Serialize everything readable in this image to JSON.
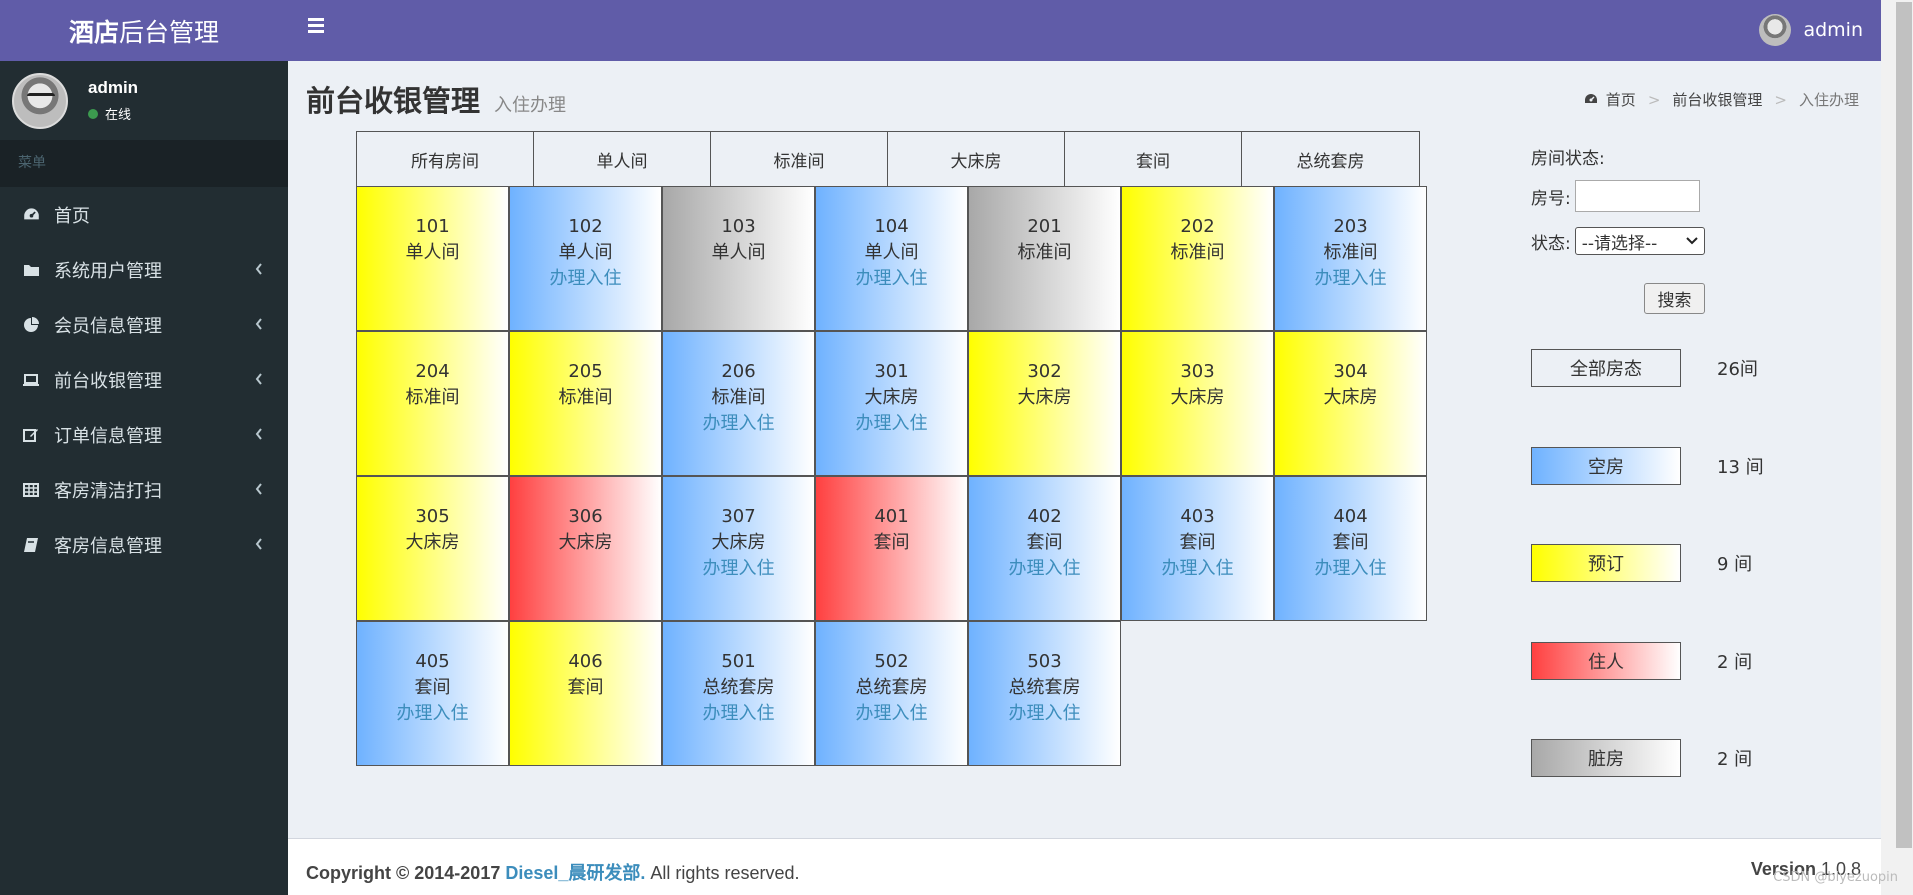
{
  "app": {
    "logo_bold": "酒店",
    "logo_light": "后台管理"
  },
  "user": {
    "name": "admin",
    "status": "在线"
  },
  "sidebar": {
    "header": "菜单",
    "items": [
      {
        "label": "首页",
        "icon": "dashboard-icon",
        "has_children": false
      },
      {
        "label": "系统用户管理",
        "icon": "folder-icon",
        "has_children": true
      },
      {
        "label": "会员信息管理",
        "icon": "pie-chart-icon",
        "has_children": true
      },
      {
        "label": "前台收银管理",
        "icon": "laptop-icon",
        "has_children": true
      },
      {
        "label": "订单信息管理",
        "icon": "edit-icon",
        "has_children": true
      },
      {
        "label": "客房清洁打扫",
        "icon": "table-icon",
        "has_children": true
      },
      {
        "label": "客房信息管理",
        "icon": "book-icon",
        "has_children": true
      }
    ]
  },
  "header": {
    "user_name": "admin"
  },
  "page": {
    "title": "前台收银管理",
    "subtitle": "入住办理"
  },
  "breadcrumb": {
    "home": "首页",
    "section": "前台收银管理",
    "current": "入住办理"
  },
  "tabs": [
    "所有房间",
    "单人间",
    "标准间",
    "大床房",
    "套间",
    "总统套房"
  ],
  "action_label": "办理入住",
  "rooms": [
    {
      "number": "101",
      "type": "单人间",
      "status": "reserved",
      "action": ""
    },
    {
      "number": "102",
      "type": "单人间",
      "status": "empty",
      "action": "办理入住"
    },
    {
      "number": "103",
      "type": "单人间",
      "status": "dirty",
      "action": ""
    },
    {
      "number": "104",
      "type": "单人间",
      "status": "empty",
      "action": "办理入住"
    },
    {
      "number": "201",
      "type": "标准间",
      "status": "dirty",
      "action": ""
    },
    {
      "number": "202",
      "type": "标准间",
      "status": "reserved",
      "action": ""
    },
    {
      "number": "203",
      "type": "标准间",
      "status": "empty",
      "action": "办理入住"
    },
    {
      "number": "204",
      "type": "标准间",
      "status": "reserved",
      "action": ""
    },
    {
      "number": "205",
      "type": "标准间",
      "status": "reserved",
      "action": ""
    },
    {
      "number": "206",
      "type": "标准间",
      "status": "empty",
      "action": "办理入住"
    },
    {
      "number": "301",
      "type": "大床房",
      "status": "empty",
      "action": "办理入住"
    },
    {
      "number": "302",
      "type": "大床房",
      "status": "reserved",
      "action": ""
    },
    {
      "number": "303",
      "type": "大床房",
      "status": "reserved",
      "action": ""
    },
    {
      "number": "304",
      "type": "大床房",
      "status": "reserved",
      "action": ""
    },
    {
      "number": "305",
      "type": "大床房",
      "status": "reserved",
      "action": ""
    },
    {
      "number": "306",
      "type": "大床房",
      "status": "occupied",
      "action": ""
    },
    {
      "number": "307",
      "type": "大床房",
      "status": "empty",
      "action": "办理入住"
    },
    {
      "number": "401",
      "type": "套间",
      "status": "occupied",
      "action": ""
    },
    {
      "number": "402",
      "type": "套间",
      "status": "empty",
      "action": "办理入住"
    },
    {
      "number": "403",
      "type": "套间",
      "status": "empty",
      "action": "办理入住"
    },
    {
      "number": "404",
      "type": "套间",
      "status": "empty",
      "action": "办理入住"
    },
    {
      "number": "405",
      "type": "套间",
      "status": "empty",
      "action": "办理入住"
    },
    {
      "number": "406",
      "type": "套间",
      "status": "reserved",
      "action": ""
    },
    {
      "number": "501",
      "type": "总统套房",
      "status": "empty",
      "action": "办理入住"
    },
    {
      "number": "502",
      "type": "总统套房",
      "status": "empty",
      "action": "办理入住"
    },
    {
      "number": "503",
      "type": "总统套房",
      "status": "empty",
      "action": "办理入住"
    }
  ],
  "filter": {
    "section_label": "房间状态:",
    "room_label": "房号:",
    "room_value": "",
    "status_label": "状态:",
    "status_selected": "--请选择--",
    "search_label": "搜索"
  },
  "legend": [
    {
      "label": "全部房态",
      "count": "26间",
      "status": "all"
    },
    {
      "label": "空房",
      "count": "13 间",
      "status": "empty"
    },
    {
      "label": "预订",
      "count": "9 间",
      "status": "reserved"
    },
    {
      "label": "住人",
      "count": "2 间",
      "status": "occupied"
    },
    {
      "label": "脏房",
      "count": "2 间",
      "status": "dirty"
    }
  ],
  "colors": {
    "header": "#605ca8",
    "sidebar": "#222d32",
    "empty": "#6fb2ff",
    "reserved": "#ffff00",
    "occupied": "#ff4040",
    "dirty": "#a8a8a8",
    "link": "#3c8dbc"
  },
  "footer": {
    "copyright_prefix": "Copyright © 2014-2017",
    "brand": "Diesel_晨研发部.",
    "rights": "All rights reserved.",
    "version_label": "Version",
    "version_value": "1.0.8"
  },
  "watermark": "CSDN @biyezuopin"
}
